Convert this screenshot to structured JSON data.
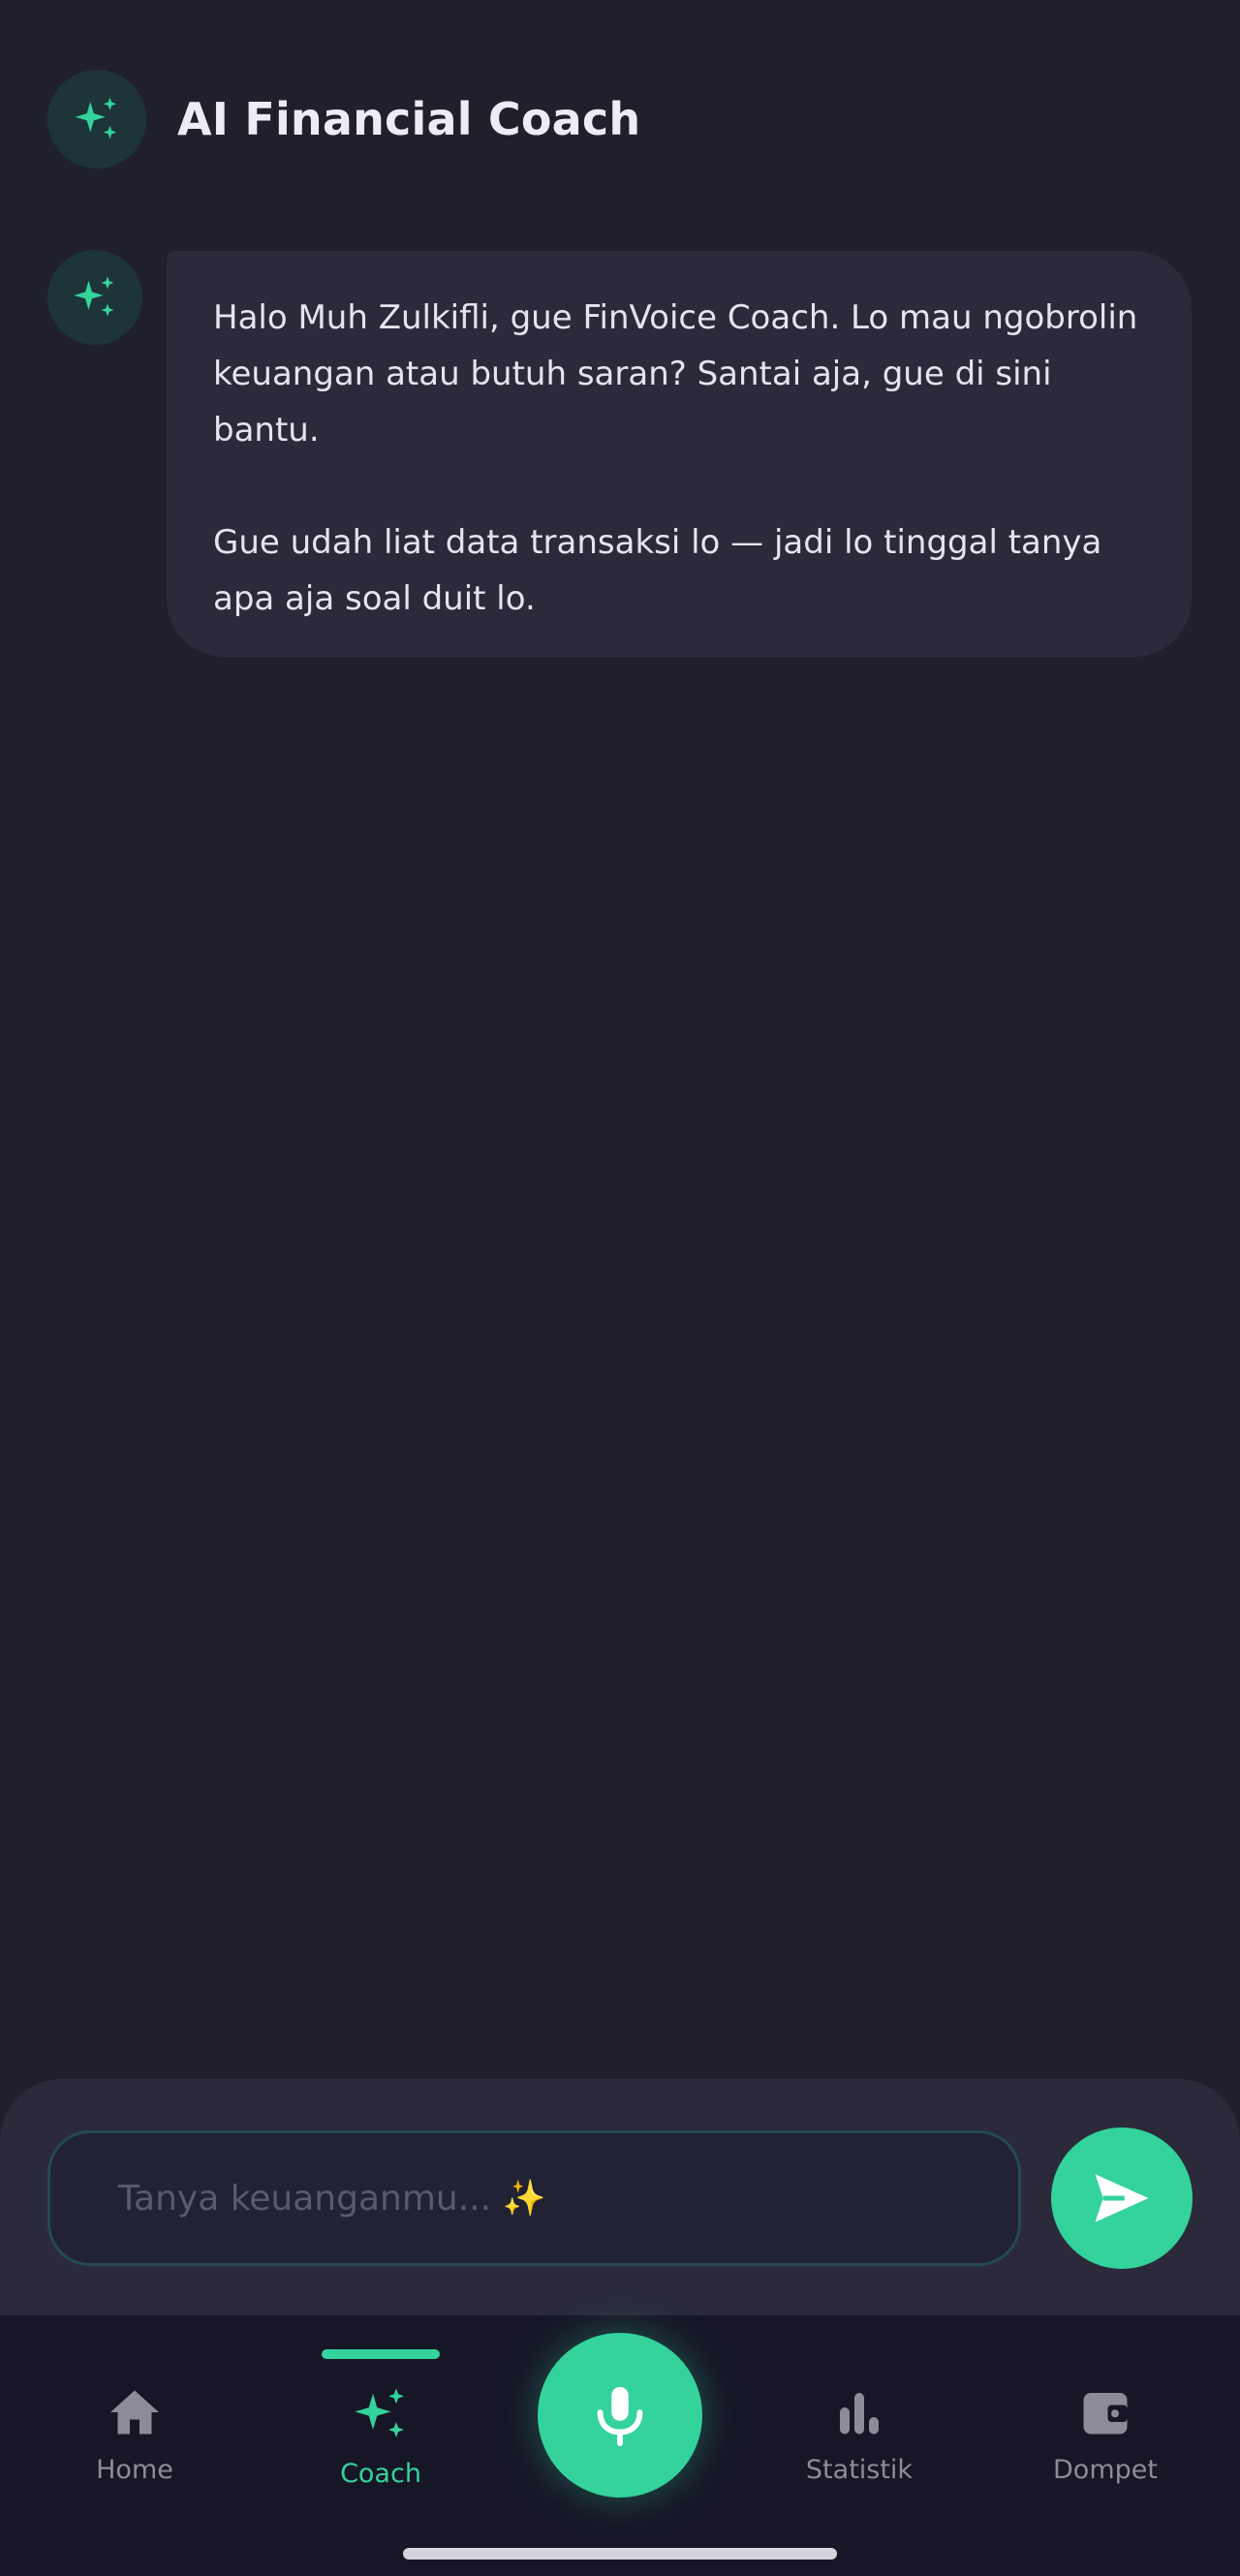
{
  "header": {
    "title": "AI Financial Coach",
    "icon": "sparkles-icon"
  },
  "chat": {
    "messages": [
      {
        "sender": "coach",
        "icon": "sparkles-icon",
        "paragraphs": [
          "Halo Muh Zulkifli, gue FinVoice Coach. Lo mau ngobrolin keuangan atau butuh saran? Santai aja, gue di sini bantu.",
          "Gue udah liat data transaksi lo — jadi lo tinggal tanya apa aja soal duit lo."
        ]
      }
    ]
  },
  "composer": {
    "placeholder": "Tanya keuanganmu... ✨",
    "value": "",
    "send_icon": "send-icon"
  },
  "nav": {
    "items": [
      {
        "label": "Home",
        "icon": "home-icon",
        "active": false
      },
      {
        "label": "Coach",
        "icon": "sparkles-icon",
        "active": true
      },
      {
        "label": "Statistik",
        "icon": "bar-chart-icon",
        "active": false
      },
      {
        "label": "Dompet",
        "icon": "wallet-icon",
        "active": false
      }
    ],
    "center_action_icon": "microphone-icon"
  },
  "colors": {
    "background": "#20202d",
    "surface": "#2a2a3b",
    "accent": "#33d39b",
    "nav_background": "#161626",
    "muted_text": "#8c8c99"
  }
}
